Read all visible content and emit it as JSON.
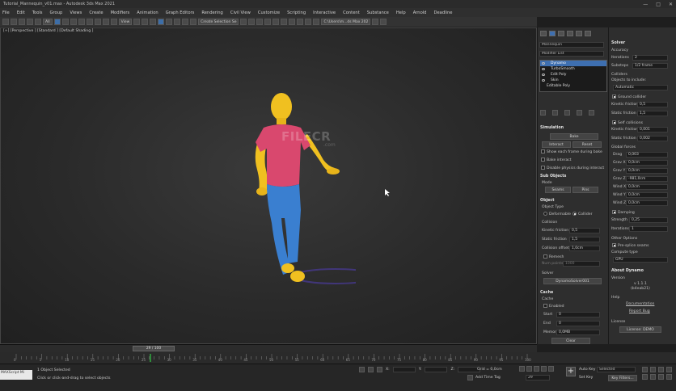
{
  "window": {
    "title": "Tutorial_Mannequin_v01.max - Autodesk 3ds Max 2021",
    "controls": [
      "—",
      "□",
      "✕"
    ]
  },
  "menu": [
    "File",
    "Edit",
    "Tools",
    "Group",
    "Views",
    "Create",
    "Modifiers",
    "Animation",
    "Graph Editors",
    "Rendering",
    "Civil View",
    "Customize",
    "Scripting",
    "Interactive",
    "Content",
    "Substance",
    "Help",
    "Arnold",
    "Deadline"
  ],
  "toolbar": {
    "filter": "All",
    "view": "View",
    "selection_set": "Create Selection Se",
    "path": "C:\\Users\\m...ds Max 202"
  },
  "viewport": {
    "label": "[+] [Perspective ] [Standard ] [Default Shading ]",
    "watermark": "FILECR",
    "watermark_sub": ".com"
  },
  "command_panel": {
    "object_name": "Mannequin",
    "modifier_list": "Modifier List",
    "stack": [
      "Dynamo",
      "TurboSmooth",
      "Edit Poly",
      "Skin",
      "Editable Poly"
    ],
    "simulation": {
      "title": "Simulation",
      "bake": "Bake",
      "interact": "Interact",
      "reset": "Reset",
      "opt1": "Show each frame during bake",
      "opt2": "Bake interact",
      "opt3": "Disable physics during interact"
    },
    "sub_objects": {
      "title": "Sub Objects",
      "mode": "Mode",
      "seams": "Seams",
      "pins": "Pins"
    },
    "object": {
      "title": "Object",
      "object_type": "Object Type",
      "deformable": "Deformable",
      "collider": "Collider",
      "collision": "Collision",
      "kinetic_label": "Kinetic friction",
      "kinetic_val": "0,5",
      "static_label": "Static friction",
      "static_val": "1,5",
      "offset_label": "Collision offset",
      "offset_val": "1,0cm",
      "remesh": "Remesh",
      "num_points": "Num points",
      "num_points_val": "1000",
      "solver": "Solver",
      "solver_val": "DynamoSolver001"
    },
    "cache": {
      "title": "Cache",
      "cache": "Cache",
      "enabled": "Enabled",
      "start_label": "Start",
      "start_val": "0",
      "end_label": "End",
      "end_val": "0",
      "memory_label": "Memory",
      "memory_val": "0,0MB",
      "clear": "Clear"
    }
  },
  "solver_panel": {
    "title": "Solver",
    "accuracy": "Accuracy",
    "iterations_label": "Iterations",
    "iterations_val": "2",
    "substeps_label": "Substeps",
    "substeps_val": "1/2 frame",
    "colliders": "Colliders",
    "objects_include": "Objects to include:",
    "automatic": "Automatic",
    "ground_collider": "Ground collider",
    "g_kinetic_label": "Kinetic friction",
    "g_kinetic_val": "0,5",
    "g_static_label": "Static friction",
    "g_static_val": "1,5",
    "self_collisions": "Self collisions",
    "s_kinetic_label": "Kinetic friction",
    "s_kinetic_val": "0,001",
    "s_static_label": "Static friction",
    "s_static_val": "0,002",
    "global_forces": "Global forces",
    "drag_label": "Drag",
    "drag_val": "0,003",
    "gravx_label": "Grav X",
    "gravx_val": "0,0cm",
    "gravy_label": "Grav Y",
    "gravy_val": "0,0cm",
    "gravz_label": "Grav Z",
    "gravz_val": "-981,0cm",
    "windx_label": "Wind X",
    "windx_val": "0,0cm",
    "windy_label": "Wind Y",
    "windy_val": "0,0cm",
    "windz_label": "Wind Z",
    "windz_val": "0,0cm",
    "damping": "Damping",
    "strength_label": "Strength",
    "strength_val": "0,25",
    "d_iter_label": "Iterations",
    "d_iter_val": "1",
    "other_options": "Other Options",
    "pre_splice": "Pre-splice seams",
    "compute": "Compute type",
    "compute_val": "GPU",
    "about": "About Dynamo",
    "version": "Version",
    "version_val": "v 1.1.1",
    "build": "(b4eab21)",
    "help": "Help",
    "documentation": "Documentation",
    "report_bug": "Report Bug",
    "license": "License",
    "license_btn": "License: DEMO"
  },
  "timeline": {
    "frame": "29 / 100",
    "ticks": [
      "0",
      "5",
      "10",
      "15",
      "20",
      "25",
      "30",
      "35",
      "40",
      "45",
      "50",
      "55",
      "60",
      "65",
      "70",
      "75",
      "80",
      "85",
      "90",
      "95",
      "100"
    ]
  },
  "status": {
    "maxscript": "MAXScript Mi",
    "selected": "1 Object Selected",
    "prompt": "Click or click-and-drag to select objects",
    "x_label": "X:",
    "y_label": "Y:",
    "z_label": "Z:",
    "grid": "Grid = 0,0cm",
    "add_time_tag": "Add Time Tag",
    "auto_key": "Auto Key",
    "selected_dd": "Selected",
    "set_key": "Set Key",
    "key_filters": "Key Filters...",
    "frame_val": "29"
  },
  "colors": {
    "accent": "#3e6fb0",
    "figure_head": "#f0c020",
    "figure_shirt": "#d9486e",
    "figure_jeans": "#3a7fd0"
  }
}
